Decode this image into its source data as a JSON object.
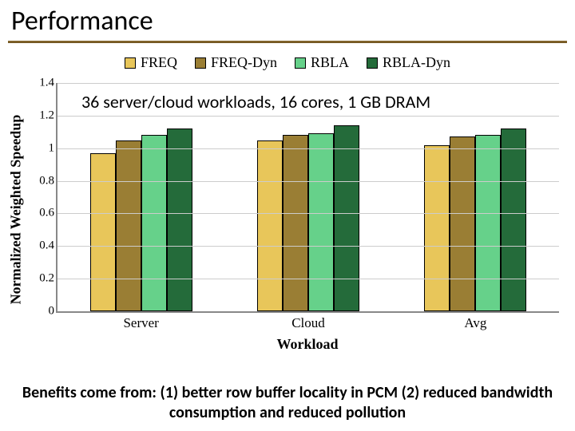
{
  "title": "Performance",
  "legend": [
    {
      "name": "FREQ",
      "class": "c-freq"
    },
    {
      "name": "FREQ-Dyn",
      "class": "c-freqdyn"
    },
    {
      "name": "RBLA",
      "class": "c-rbla"
    },
    {
      "name": "RBLA-Dyn",
      "class": "c-rbladyn"
    }
  ],
  "ylabel": "Normalized Weighted Speedup",
  "xlabel": "Workload",
  "annotation": "36 server/cloud workloads, 16 cores, 1 GB DRAM",
  "caption": "Benefits come from:  (1) better row buffer locality in PCM (2) reduced bandwidth consumption and reduced pollution",
  "chart_data": {
    "type": "bar",
    "ylim": [
      0,
      1.4
    ],
    "yticks": [
      0,
      0.2,
      0.4,
      0.6,
      0.8,
      1,
      1.2,
      1.4
    ],
    "categories": [
      "Server",
      "Cloud",
      "Avg"
    ],
    "series": [
      {
        "name": "FREQ",
        "values": [
          0.97,
          1.05,
          1.02
        ],
        "class": "c-freq"
      },
      {
        "name": "FREQ-Dyn",
        "values": [
          1.05,
          1.08,
          1.07
        ],
        "class": "c-freqdyn"
      },
      {
        "name": "RBLA",
        "values": [
          1.08,
          1.09,
          1.08
        ],
        "class": "c-rbla"
      },
      {
        "name": "RBLA-Dyn",
        "values": [
          1.12,
          1.14,
          1.12
        ],
        "class": "c-rbladyn"
      }
    ],
    "title": "Performance",
    "xlabel": "Workload",
    "ylabel": "Normalized Weighted Speedup"
  }
}
